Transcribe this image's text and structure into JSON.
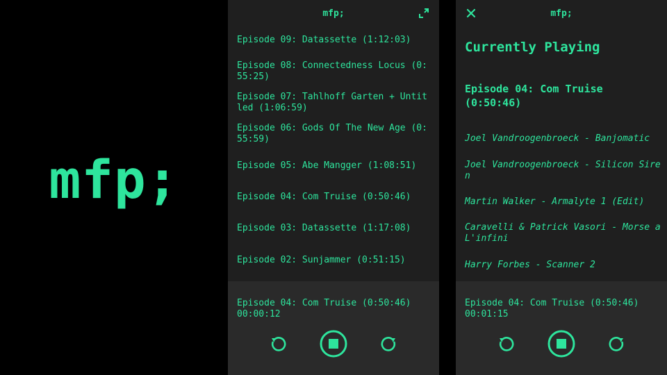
{
  "brand": {
    "logo_text": "mfp;",
    "accent_color": "#2ee59d"
  },
  "list_screen": {
    "app_title": "mfp;",
    "episodes": [
      {
        "label": "Episode 09: Datassette (1:12:03)"
      },
      {
        "label": "Episode 08: Connectedness Locus (0:55:25)"
      },
      {
        "label": "Episode 07: Tahlhoff Garten + Untitled (1:06:59)"
      },
      {
        "label": "Episode 06: Gods Of The New Age (0:55:59)"
      },
      {
        "label": "Episode 05: Abe Mangger (1:08:51)"
      },
      {
        "label": "Episode 04: Com Truise (0:50:46)"
      },
      {
        "label": "Episode 03: Datassette (1:17:08)"
      },
      {
        "label": "Episode 02: Sunjammer (0:51:15)"
      }
    ],
    "player": {
      "title": "Episode 04: Com Truise (0:50:46)",
      "elapsed": "00:00:12"
    }
  },
  "detail_screen": {
    "app_title": "mfp;",
    "heading": "Currently Playing",
    "episode": "Episode 04: Com Truise (0:50:46)",
    "tracks": [
      {
        "label": "Joel Vandroogenbroeck - Banjomatic"
      },
      {
        "label": "Joel Vandroogenbroeck - Silicon Siren"
      },
      {
        "label": "Martin Walker - Armalyte 1 (Edit)"
      },
      {
        "label": "Caravelli & Patrick Vasori - Morse a L'infini"
      },
      {
        "label": "Harry Forbes - Scanner 2"
      }
    ],
    "player": {
      "title": "Episode 04: Com Truise (0:50:46)",
      "elapsed": "00:01:15"
    }
  },
  "icons": {
    "expand": "expand-icon",
    "close": "close-icon",
    "rewind": "rewind-icon",
    "stop": "stop-icon",
    "forward": "forward-icon"
  }
}
